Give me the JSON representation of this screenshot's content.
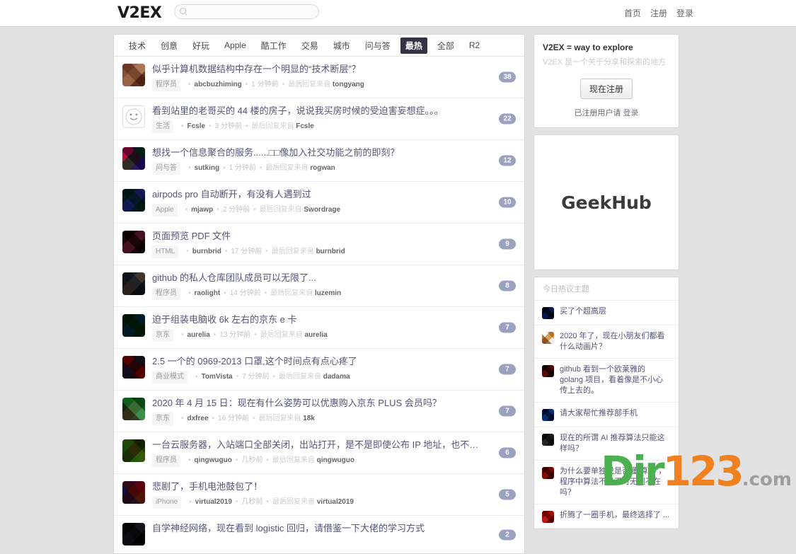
{
  "header": {
    "logo": "V2EX",
    "search_placeholder": "",
    "search_value": "",
    "nav": [
      {
        "label": "首页"
      },
      {
        "label": "注册"
      },
      {
        "label": "登录"
      }
    ]
  },
  "tabs": [
    {
      "label": "技术",
      "active": false
    },
    {
      "label": "创意",
      "active": false
    },
    {
      "label": "好玩",
      "active": false
    },
    {
      "label": "Apple",
      "active": false
    },
    {
      "label": "酷工作",
      "active": false
    },
    {
      "label": "交易",
      "active": false
    },
    {
      "label": "城市",
      "active": false
    },
    {
      "label": "问与答",
      "active": false
    },
    {
      "label": "最热",
      "active": true
    },
    {
      "label": "全部",
      "active": false
    },
    {
      "label": "R2",
      "active": false
    }
  ],
  "meta_labels": {
    "last_reply_prefix": "最后回复来自",
    "separator": "•"
  },
  "topics": [
    {
      "title": "似乎计算机数据结构中存在一个明显的“技术断层”？",
      "node": "程序员",
      "author": "abcbuzhiming",
      "ago": "1 分钟前",
      "replier": "tongyang",
      "count": "38",
      "avatar_colors": [
        "#c9a38f",
        "#e8d2c0",
        "#8f6a55",
        "#d6b9a4",
        "#a8836d",
        "#f0e0d0"
      ]
    },
    {
      "title": "看到站里的老哥买的 44 楼的房子，说说我买房时候的受迫害妄想症。。。",
      "node": "生活",
      "author": "Fcsle",
      "ago": "3 分钟前",
      "replier": "Fcsle",
      "count": "22",
      "avatar_colors": [
        "#ffffff",
        "#ffffff",
        "#fafafa",
        "#ffffff",
        "#f5f5f5",
        "#ffffff"
      ],
      "avatar_smiley": true
    },
    {
      "title": "想找一个信息聚合的服务......□□像加入社交功能之前的即刻？",
      "node": "问与答",
      "author": "sutking",
      "ago": "1 分钟前",
      "replier": "rogwan",
      "count": "12",
      "avatar_colors": [
        "#e0407a",
        "#3bb54a",
        "#2f6fd0",
        "#f0f0f0",
        "#8a4fc0",
        "#20b0a0"
      ]
    },
    {
      "title": "airpods pro 自动断开，有没有人遇到过",
      "node": "Apple",
      "author": "mjawp",
      "ago": "2 分钟前",
      "replier": "Swordrage",
      "count": "10",
      "avatar_colors": [
        "#1f6f6a",
        "#c678dd",
        "#1f6f6a",
        "#c678dd",
        "#1f6f6a",
        "#c678dd"
      ]
    },
    {
      "title": "页面预览 PDF 文件",
      "node": "HTML",
      "author": "burnbrid",
      "ago": "17 分钟前",
      "replier": "burnbrid",
      "count": "9",
      "avatar_colors": [
        "#5c2b2b",
        "#d9a6d9",
        "#5c2b2b",
        "#d9a6d9",
        "#5c2b2b",
        "#d9a6d9"
      ]
    },
    {
      "title": "github 的私人仓库团队成员可以无限了...",
      "node": "程序员",
      "author": "raolight",
      "ago": "14 分钟前",
      "replier": "luzemin",
      "count": "8",
      "avatar_colors": [
        "#5a6470",
        "#c8a88a",
        "#3a4450",
        "#9a8070",
        "#70808f",
        "#e0d0c0"
      ]
    },
    {
      "title": "迫于组装电脑收 6k 左右的京东 e 卡",
      "node": "京东",
      "author": "aurelia",
      "ago": "13 分钟前",
      "replier": "aurelia",
      "count": "7",
      "avatar_colors": [
        "#2e6b35",
        "#2f7fd0",
        "#2e6b35",
        "#2f7fd0",
        "#2e6b35",
        "#2f7fd0"
      ]
    },
    {
      "title": "2.5 一个的 0969-2013 口罩,这个时间点有点心疼了",
      "node": "商业模式",
      "author": "TomVista",
      "ago": "7 分钟前",
      "replier": "dadama",
      "count": "7",
      "avatar_colors": [
        "#b02020",
        "#4aa8e8",
        "#b02020",
        "#4aa8e8",
        "#b02020",
        "#4aa8e8"
      ]
    },
    {
      "title": "2020 年 4 月 15 日：现在有什么姿势可以优惠购入京东 PLUS 会员吗？",
      "node": "京东",
      "author": "dxfree",
      "ago": "16 分钟前",
      "replier": "18k",
      "count": "7",
      "avatar_colors": [
        "#3fa860",
        "#f0c0b0",
        "#ffffff",
        "#d06050",
        "#f8d8c8",
        "#2f8850"
      ]
    },
    {
      "title": "一台云服务器，入站端口全部关闭，出站打开，是不是即使公布 IP 地址，也不会被攻击",
      "node": "程序员",
      "author": "qingwuguo",
      "ago": "几秒前",
      "replier": "qingwuguo",
      "count": "6",
      "avatar_colors": [
        "#6aa84f",
        "#8a6a30",
        "#a8d070",
        "#6aa84f",
        "#c0a060",
        "#507030"
      ]
    },
    {
      "title": "悲剧了，手机电池鼓包了！",
      "node": "iPhone",
      "author": "virtual2019",
      "ago": "几秒前",
      "replier": "virtual2019",
      "count": "5",
      "avatar_colors": [
        "#8a4aa8",
        "#d04030",
        "#e0a030",
        "#4a6ab0",
        "#a07030",
        "#c05060"
      ]
    },
    {
      "title": "自学神经网络，现在看到 logistic 回归，请借鉴一下大佬的学习方式",
      "node": "",
      "author": "",
      "ago": "",
      "replier": "",
      "count": "2",
      "avatar_colors": [
        "#3a3a40",
        "#8a8a90",
        "#202025",
        "#6a6a72",
        "#4a4a52",
        "#b0b0b8"
      ]
    }
  ],
  "sidebar": {
    "promo": {
      "title": "V2EX = way to explore",
      "subtitle": "V2EX 是一个关于分享和探索的地方",
      "register_button": "现在注册",
      "login_prefix": "已注册用户请",
      "login_link": "登录"
    },
    "ad": {
      "text": "GeekHub"
    },
    "hot_header": "今日热议主题",
    "hot_topics": [
      {
        "title": "买了个超高层",
        "avatar_colors": [
          "#1a3a6a",
          "#4a9ad0",
          "#1a3a6a",
          "#6ab0e0",
          "#20406a",
          "#80c0e8"
        ]
      },
      {
        "title": "2020 年了，现在小朋友们都看什么动画片？",
        "avatar_colors": [
          "#ffffff",
          "#d0a060",
          "#f0f0f0",
          "#b08040",
          "#ffffff",
          "#e0b070"
        ]
      },
      {
        "title": "github 看到一个欧莱雅的 golang 项目，看着像是不小心传上去的。",
        "avatar_colors": [
          "#6a3a1a",
          "#e060a0",
          "#4a2a10",
          "#f080b0",
          "#6a3a1a",
          "#d05090"
        ]
      },
      {
        "title": "请大家帮忙推荐部手机",
        "avatar_colors": [
          "#1a4a8a",
          "#70c0e0",
          "#1a4a8a",
          "#90d0f0",
          "#205090",
          "#a0d8f0"
        ]
      },
      {
        "title": "现在的所谓 AI 推荐算法只能这样吗？",
        "avatar_colors": [
          "#3a3a3a",
          "#c0c0c0",
          "#5a5a5a",
          "#e0e0e0",
          "#707070",
          "#a0a0a0"
        ]
      },
      {
        "title": "为什么要单独说是否懂“算法”，程序中算法不是无时无刻不在吗？",
        "avatar_colors": [
          "#a03020",
          "#e08050",
          "#802010",
          "#f0a070",
          "#903020",
          "#d07040"
        ]
      },
      {
        "title": "折腾了一圈手机，最终选择了 ...",
        "avatar_colors": [
          "#c02020",
          "#f0c0c0",
          "#a01010",
          "#ffffff",
          "#b01818",
          "#e0a0a0"
        ]
      }
    ]
  },
  "watermark": {
    "green": "Dir",
    "orange": "123",
    "suffix": ".com"
  }
}
